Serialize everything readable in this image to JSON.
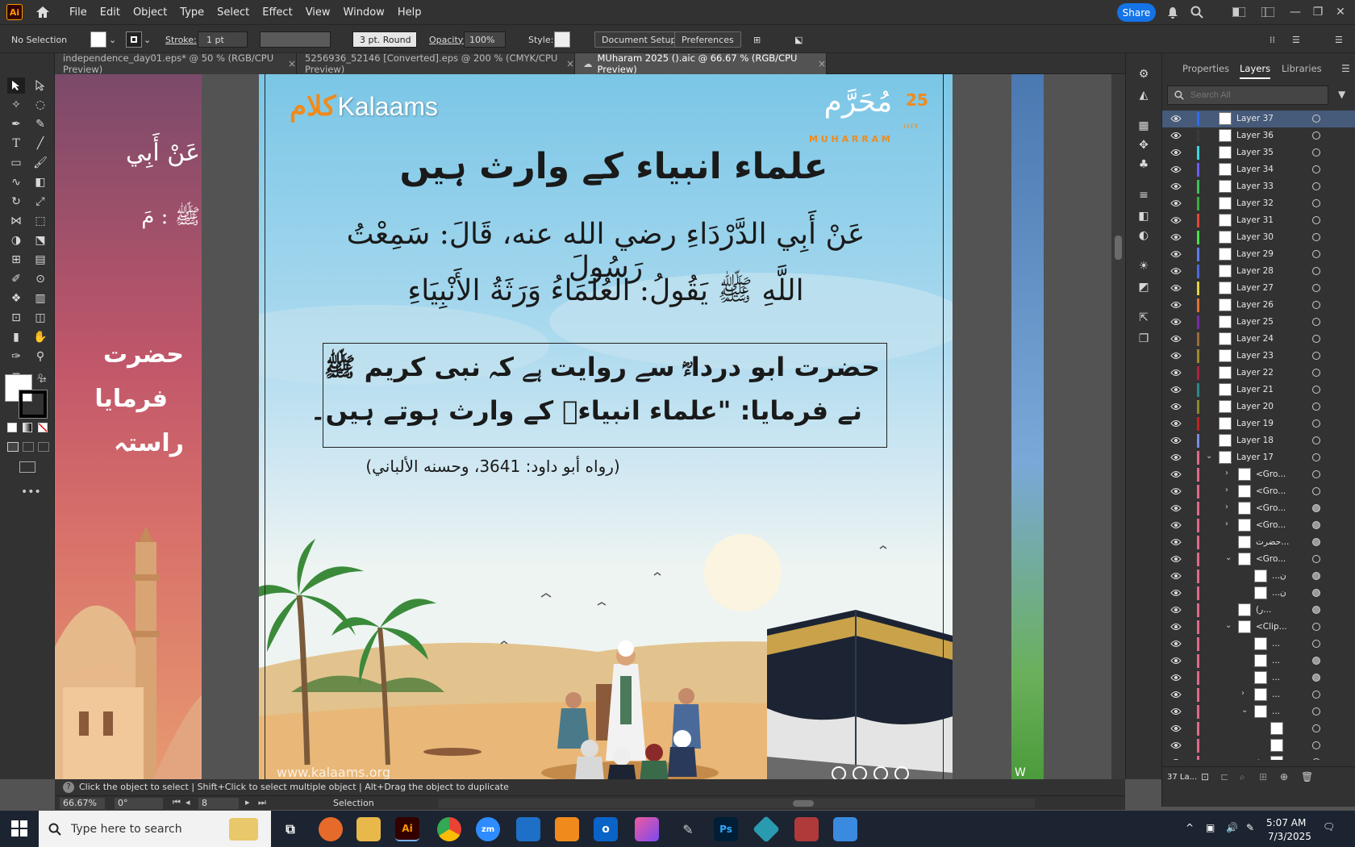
{
  "app": {
    "logo": "Ai",
    "menu": [
      "File",
      "Edit",
      "Object",
      "Type",
      "Select",
      "Effect",
      "View",
      "Window",
      "Help"
    ],
    "share_label": "Share"
  },
  "control": {
    "selection": "No Selection",
    "stroke_label": "Stroke:",
    "stroke_value": "1 pt",
    "brush": "3 pt. Round",
    "opacity_label": "Opacity:",
    "opacity_value": "100%",
    "style_label": "Style:",
    "doc_setup": "Document Setup",
    "preferences": "Preferences"
  },
  "tabs": [
    {
      "label": "independence_day01.eps* @ 50 % (RGB/CPU Preview)",
      "close": "×"
    },
    {
      "label": "5256936_52146 [Converted].eps @ 200 % (CMYK/CPU Preview)",
      "close": "×"
    },
    {
      "label": "MUharam 2025 ().aic @ 66.67 % (RGB/CPU Preview)",
      "close": "×"
    }
  ],
  "artwork": {
    "brand": "Kalaams",
    "brand_mark": "کلام",
    "muharram_ar": "مُحَرَّم",
    "muharram_num": "25",
    "muharram_en": "M U H A R R A M",
    "muharram_year": "١٤٤٧",
    "title_urdu": "علماء انبیاء کے وارث ہیں",
    "hadith_line1": "عَنْ أَبِي الدَّرْدَاءِ رضي الله عنه، قَالَ: سَمِعْتُ رَسُولَ",
    "hadith_line2": "اللَّهِ ﷺ يَقُولُ: العُلَمَاءُ وَرَثَةُ الأَنْبِيَاءِ",
    "urdu_line1": "حضرت ابو درداءؓ سے روایت ہے کہ نبی کریم ﷺ",
    "urdu_line2": "نے فرمایا: \"علماء انبیاءؑ کے وارث ہوتے ہیں۔",
    "reference": "(رواه أبو داود: 3641، وحسنه الألباني)",
    "website": "www.kalaams.org",
    "left_ar1": "عَنْ أَبِي",
    "left_ar2": "ﷺ : مَ",
    "left_ur1": "حضرت",
    "left_ur2": "فرمایا",
    "left_ur3": "راستہ",
    "right_edge": "W"
  },
  "panel": {
    "tabs": [
      "Properties",
      "Layers",
      "Libraries"
    ],
    "search_placeholder": "Search All",
    "layers": [
      {
        "name": "Layer 37",
        "color": "#2d6cf0",
        "selected": true
      },
      {
        "name": "Layer 36",
        "color": "#3a3a3a"
      },
      {
        "name": "Layer 35",
        "color": "#39d6e0"
      },
      {
        "name": "Layer 34",
        "color": "#6a5cff"
      },
      {
        "name": "Layer 33",
        "color": "#3ec15a"
      },
      {
        "name": "Layer 32",
        "color": "#3caa3c"
      },
      {
        "name": "Layer 31",
        "color": "#e8443a"
      },
      {
        "name": "Layer 30",
        "color": "#48e048"
      },
      {
        "name": "Layer 29",
        "color": "#5a7cf0"
      },
      {
        "name": "Layer 28",
        "color": "#4a6ae0"
      },
      {
        "name": "Layer 27",
        "color": "#e0d040"
      },
      {
        "name": "Layer 26",
        "color": "#e07030"
      },
      {
        "name": "Layer 25",
        "color": "#7a2aa8"
      },
      {
        "name": "Layer 24",
        "color": "#9a6a3a"
      },
      {
        "name": "Layer 23",
        "color": "#9a8a2a"
      },
      {
        "name": "Layer 22",
        "color": "#b02040"
      },
      {
        "name": "Layer 21",
        "color": "#2a8a8a"
      },
      {
        "name": "Layer 20",
        "color": "#8a8a2a"
      },
      {
        "name": "Layer 19",
        "color": "#c02020"
      },
      {
        "name": "Layer 18",
        "color": "#7a8ae0"
      },
      {
        "name": "Layer 17",
        "color": "#e06a8a",
        "expanded": true
      }
    ],
    "sublayers": [
      {
        "name": "<Gro...",
        "depth": 1,
        "arrow": "›",
        "filled": false
      },
      {
        "name": "<Gro...",
        "depth": 1,
        "arrow": "›",
        "filled": false
      },
      {
        "name": "<Gro...",
        "depth": 1,
        "arrow": "›",
        "filled": true
      },
      {
        "name": "<Gro...",
        "depth": 1,
        "arrow": "›",
        "filled": true
      },
      {
        "name": "حضرت...",
        "depth": 1,
        "arrow": "",
        "filled": true
      },
      {
        "name": "<Gro...",
        "depth": 1,
        "arrow": "⌄",
        "filled": false
      },
      {
        "name": "...ن",
        "depth": 2,
        "arrow": "",
        "filled": true
      },
      {
        "name": "...ن",
        "depth": 2,
        "arrow": "",
        "filled": true
      },
      {
        "name": "(ر...",
        "depth": 1,
        "arrow": "",
        "filled": true
      },
      {
        "name": "<Clip...",
        "depth": 1,
        "arrow": "⌄",
        "filled": false
      },
      {
        "name": "...",
        "depth": 2,
        "arrow": "",
        "filled": false
      },
      {
        "name": "...",
        "depth": 2,
        "arrow": "",
        "filled": true
      },
      {
        "name": "...",
        "depth": 2,
        "arrow": "",
        "filled": true
      },
      {
        "name": "...",
        "depth": 2,
        "arrow": "›",
        "filled": false
      },
      {
        "name": "...",
        "depth": 2,
        "arrow": "⌄",
        "filled": false
      },
      {
        "name": "",
        "depth": 3,
        "arrow": "",
        "filled": false
      },
      {
        "name": "",
        "depth": 3,
        "arrow": "",
        "filled": false
      },
      {
        "name": "",
        "depth": 3,
        "arrow": "›",
        "filled": false
      }
    ],
    "footer_count": "37 La..."
  },
  "status": {
    "hint": "Click the object to select  |  Shift+Click to select multiple object  |  Alt+Drag the object to duplicate",
    "zoom": "66.67%",
    "angle": "0°",
    "page": "8",
    "tool": "Selection"
  },
  "taskbar": {
    "search_placeholder": "Type here to search",
    "time": "5:07 AM",
    "date": "7/3/2025"
  },
  "colors": {
    "accent": "#1473e6",
    "sky": "#8cc9e6",
    "sand": "#e8b878",
    "kaaba": "#1c2433",
    "gold": "#c9a24a",
    "orange": "#f08a1c"
  }
}
